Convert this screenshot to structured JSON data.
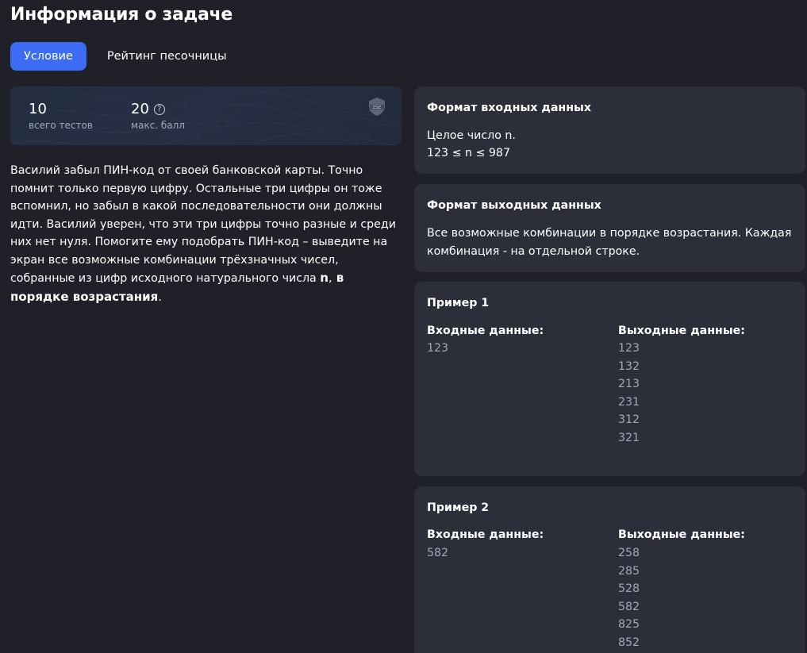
{
  "page": {
    "title": "Информация о задаче"
  },
  "tabs": [
    {
      "label": "Условие",
      "active": true
    },
    {
      "label": "Рейтинг песочницы",
      "active": false
    }
  ],
  "stats": {
    "tests_value": "10",
    "tests_label": "всего тестов",
    "score_value": "20",
    "score_label": "макс. балл",
    "help_glyph": "?",
    "badge_icon": "shield-badge-icon",
    "badge_text": "ZSE"
  },
  "description": {
    "part1": "Василий забыл ПИН-код от своей банковской карты. Точно помнит только первую цифру. Остальные три цифры он тоже вспомнил, но забыл в какой последовательности они должны идти. Василий уверен, что эти три цифры точно разные и среди них нет нуля. Помогите ему подобрать ПИН-код – выведите на экран все возможные комбинации трёхзначных чисел, собранные из цифр исходного натурального числа ",
    "var": "n",
    "comma": ",",
    "order": " в порядке возрастания",
    "end": "."
  },
  "input_format": {
    "title": "Формат входных данных",
    "line1": "Целое число n.",
    "line2": "123 ≤ n ≤ 987"
  },
  "output_format": {
    "title": "Формат выходных данных",
    "text": "Все возможные комбинации в порядке возрастания. Каждая комбинация - на отдельной строке."
  },
  "examples": [
    {
      "title": "Пример 1",
      "input_label": "Входные данные:",
      "output_label": "Выходные данные:",
      "input": [
        "123"
      ],
      "output": [
        "123",
        "132",
        "213",
        "231",
        "312",
        "321"
      ]
    },
    {
      "title": "Пример 2",
      "input_label": "Входные данные:",
      "output_label": "Выходные данные:",
      "input": [
        "582"
      ],
      "output": [
        "258",
        "285",
        "528",
        "582",
        "825",
        "852"
      ]
    }
  ],
  "colors": {
    "background": "#1f2028",
    "card": "#2c2e3a",
    "accent": "#3c6cf5",
    "muted_text": "#a3a8b8"
  }
}
